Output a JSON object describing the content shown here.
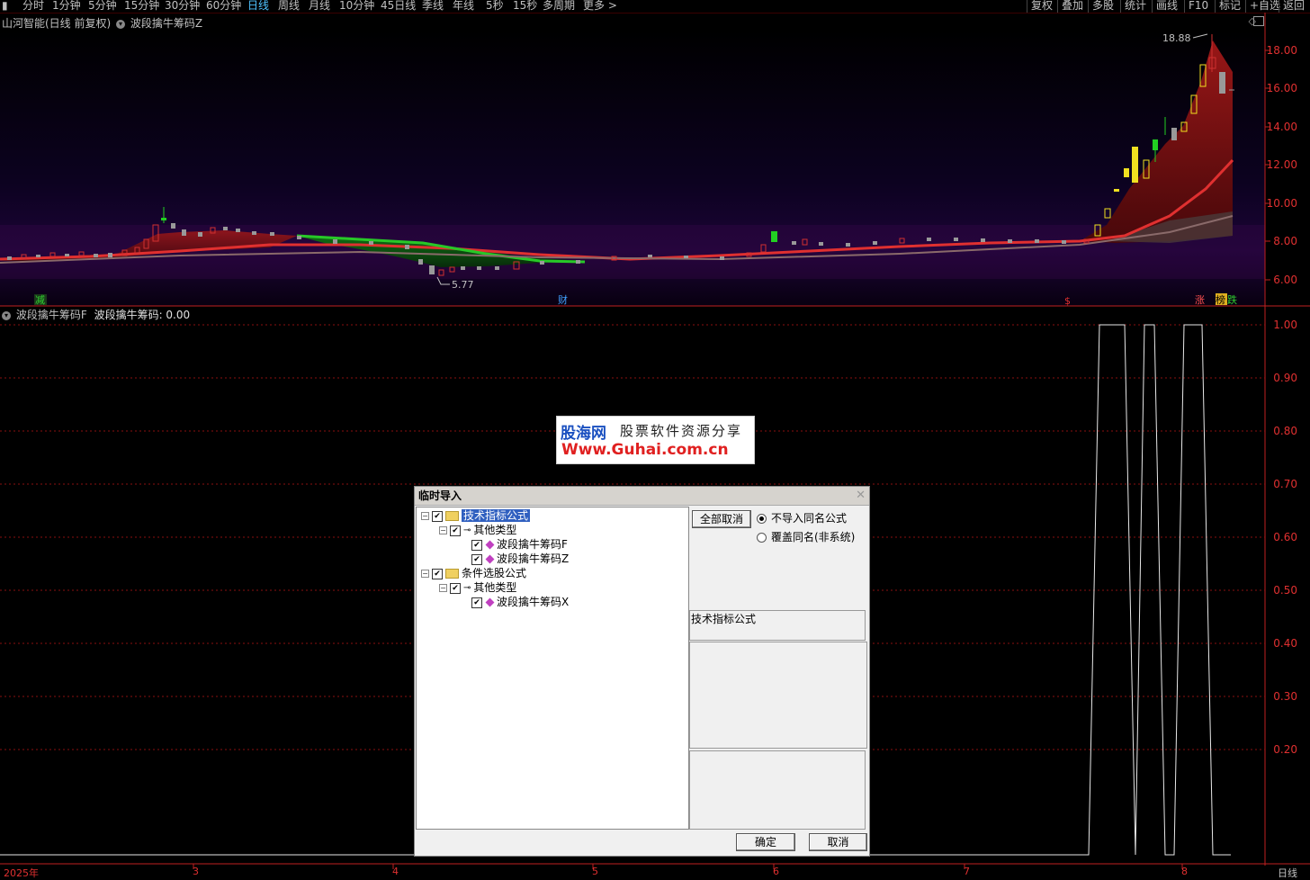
{
  "topbar": {
    "periods": [
      "分时",
      "1分钟",
      "5分钟",
      "15分钟",
      "30分钟",
      "60分钟",
      "日线",
      "周线",
      "月线",
      "10分钟",
      "45日线",
      "季线",
      "年线",
      "5秒",
      "15秒",
      "多周期",
      "更多 >"
    ],
    "active_period": "日线",
    "tools": [
      "复权",
      "叠加",
      "多股",
      "统计",
      "画线",
      "F10",
      "标记",
      "+自选",
      "返回"
    ]
  },
  "main_chart": {
    "title": "山河智能(日线 前复权)",
    "indicator": "波段擒牛筹码Z",
    "y_ticks": [
      "18.00",
      "16.00",
      "14.00",
      "12.00",
      "10.00",
      "8.00",
      "6.00"
    ],
    "high_label": "18.88",
    "low_label": "5.77",
    "markers": [
      "减",
      "财",
      "$",
      "涨",
      "榜",
      "跌"
    ]
  },
  "sub_chart": {
    "title": "波段擒牛筹码F",
    "value_label": "波段擒牛筹码: 0.00",
    "y_ticks": [
      "1.00",
      "0.90",
      "0.80",
      "0.70",
      "0.60",
      "0.50",
      "0.40",
      "0.30",
      "0.20"
    ]
  },
  "x_axis": {
    "labels": [
      "2025年",
      "3",
      "4",
      "5",
      "6",
      "7",
      "8"
    ],
    "right_label": "日线"
  },
  "watermark": {
    "logo": "股海网",
    "tagline": "股票软件资源分享",
    "url": "Www.Guhai.com.cn"
  },
  "dialog": {
    "title": "临时导入",
    "tree": [
      {
        "label": "技术指标公式",
        "level": 0,
        "type": "folder",
        "selected": true
      },
      {
        "label": "其他类型",
        "level": 1,
        "type": "key"
      },
      {
        "label": "波段擒牛筹码F",
        "level": 2,
        "type": "item"
      },
      {
        "label": "波段擒牛筹码Z",
        "level": 2,
        "type": "item"
      },
      {
        "label": "条件选股公式",
        "level": 0,
        "type": "folder"
      },
      {
        "label": "其他类型",
        "level": 1,
        "type": "key"
      },
      {
        "label": "波段擒牛筹码X",
        "level": 2,
        "type": "item"
      }
    ],
    "cancel_all_label": "全部取消",
    "radio_no_import": "不导入同名公式",
    "radio_overwrite": "覆盖同名(非系统)",
    "info_label": "技术指标公式",
    "ok_label": "确定",
    "cancel_label": "取消"
  },
  "chart_data": {
    "type": "line",
    "title": "",
    "sub_series_values": [
      0,
      0,
      0,
      0,
      0,
      0,
      0,
      0,
      0,
      0,
      0,
      0,
      0,
      0,
      0,
      0,
      0,
      0,
      0,
      0,
      0,
      0,
      1,
      1,
      1,
      0,
      1,
      1,
      0,
      0,
      1,
      1,
      0,
      0
    ],
    "ylim": [
      0.1,
      1.05
    ]
  }
}
